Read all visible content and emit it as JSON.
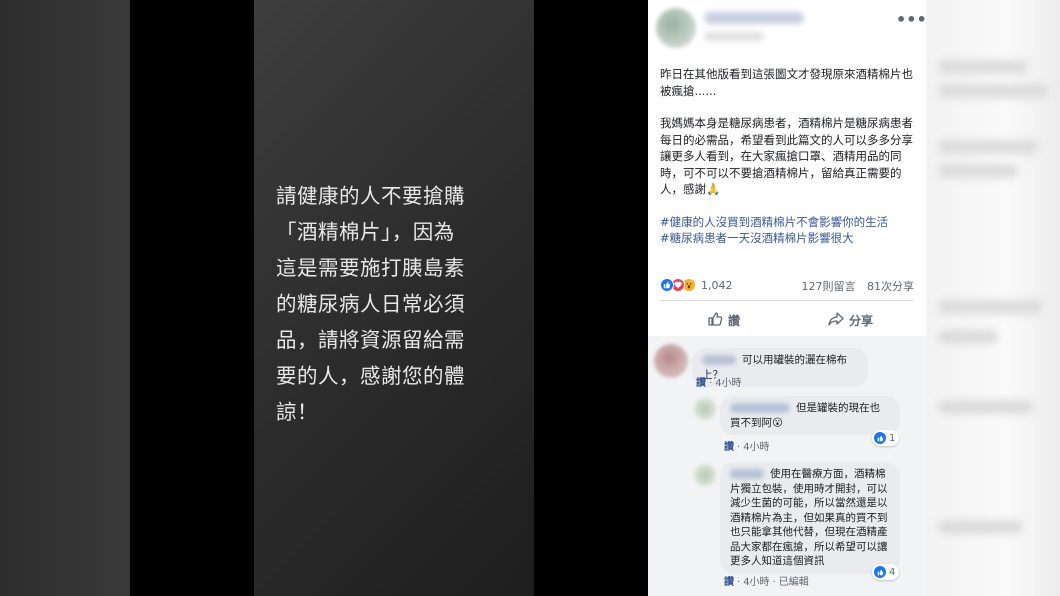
{
  "image_text": "請健康的人不要搶購\n「酒精棉片」，因為\n這是需要施打胰島素\n的糖尿病人日常必須\n品，請將資源留給需\n要的人，感謝您的體\n諒！",
  "post": {
    "text_1": "昨日在其他版看到這張圖文才發現原來酒精棉片也被瘋搶......",
    "text_2": "我媽媽本身是糖尿病患者，酒精棉片是糖尿病患者每日的必需品，希望看到此篇文的人可以多多分享讓更多人看到，在大家瘋搶口罩、酒精用品的同時，可不可以不要搶酒精棉片，留給真正需要的人，感謝🙏",
    "hashtag_1": "#健康的人沒買到酒精棉片不會影響你的生活",
    "hashtag_2": "#糖尿病患者一天沒酒精棉片影響很大",
    "reaction_count": "1,042",
    "comments_count": "127則留言",
    "shares_count": "81次分享",
    "like_label": "讚",
    "share_label": "分享"
  },
  "comments": [
    {
      "text": "可以用罐裝的灑在棉布上？",
      "like_label": "讚",
      "time": "4小時"
    },
    {
      "text": "但是罐裝的現在也買不到阿😮",
      "like_label": "讚",
      "time": "4小時",
      "likes": "1"
    },
    {
      "text": "使用在醫療方面，酒精棉片獨立包裝，使用時才開封，可以減少生菌的可能，所以當然還是以酒精棉片為主，但如果真的買不到也只能拿其他代替，但現在酒精產品大家都在瘋搶，所以希望可以讓更多人知道這個資訊",
      "like_label": "讚",
      "time": "4小時",
      "edited": "已編輯",
      "likes": "4"
    }
  ],
  "icons": {
    "more": "more-dots-icon",
    "like": "thumbs-up-icon",
    "share": "share-arrow-icon"
  },
  "colors": {
    "link": "#385898",
    "like_blue": "#1877f2",
    "love_red": "#f33e58",
    "wow_yellow": "#f7b125"
  }
}
